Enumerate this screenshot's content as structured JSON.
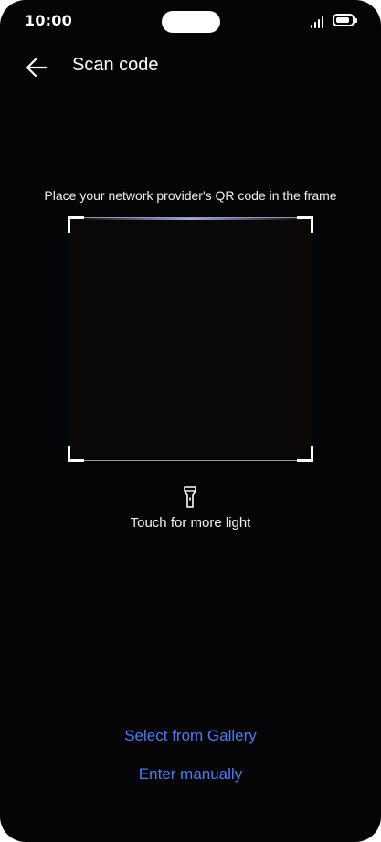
{
  "status_bar": {
    "time": "10:00",
    "signal_icon": "signal-icon",
    "battery_icon": "battery-icon"
  },
  "header": {
    "back_icon": "arrow-left-icon",
    "title": "Scan code"
  },
  "scanner": {
    "instruction": "Place your network provider's QR code in the frame",
    "torch_icon": "flashlight-icon",
    "torch_label": "Touch for more light"
  },
  "actions": {
    "select_gallery": "Select from Gallery",
    "enter_manually": "Enter manually"
  },
  "colors": {
    "background": "#050407",
    "accent": "#4a7cf0",
    "text": "#ffffff"
  }
}
